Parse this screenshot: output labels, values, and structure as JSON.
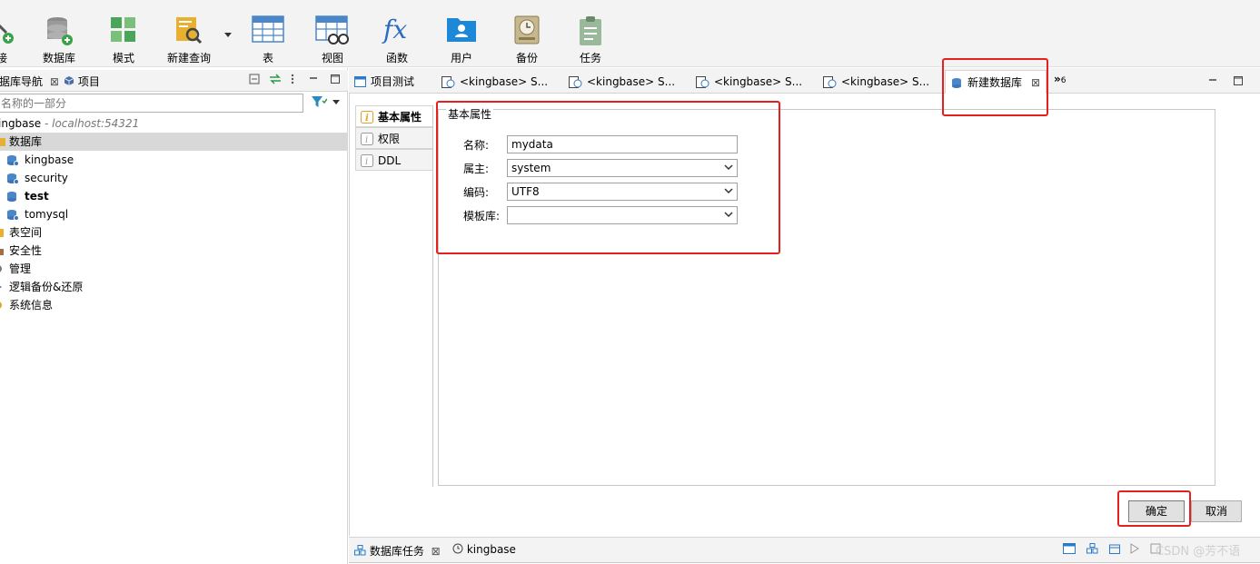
{
  "toolbar": {
    "items": [
      {
        "label": "接",
        "icon": "connect-icon"
      },
      {
        "label": "数据库",
        "icon": "database-add-icon"
      },
      {
        "label": "模式",
        "icon": "schema-icon"
      },
      {
        "label": "新建查询",
        "icon": "new-query-icon"
      },
      {
        "label": "表",
        "icon": "table-icon"
      },
      {
        "label": "视图",
        "icon": "view-icon"
      },
      {
        "label": "函数",
        "icon": "function-icon"
      },
      {
        "label": "用户",
        "icon": "user-icon"
      },
      {
        "label": "备份",
        "icon": "backup-icon"
      },
      {
        "label": "任务",
        "icon": "task-icon"
      }
    ]
  },
  "left_panel": {
    "tabs": [
      {
        "label": "据库导航"
      },
      {
        "label": "项目"
      }
    ],
    "filter": {
      "placeholder": "名称的一部分"
    },
    "tree": [
      {
        "label": "ingbase",
        "host": " - localhost:54321"
      },
      {
        "label": "数据库"
      },
      {
        "label": "kingbase"
      },
      {
        "label": "security"
      },
      {
        "label": "test"
      },
      {
        "label": "tomysql"
      },
      {
        "label": "表空间"
      },
      {
        "label": "安全性"
      },
      {
        "label": "管理"
      },
      {
        "label": "逻辑备份&还原"
      },
      {
        "label": "系统信息"
      }
    ]
  },
  "editor": {
    "tabs": [
      {
        "label": "项目测试"
      },
      {
        "label": "<kingbase> S..."
      },
      {
        "label": "<kingbase> S..."
      },
      {
        "label": "<kingbase> S..."
      },
      {
        "label": "<kingbase> S..."
      },
      {
        "label": "新建数据库"
      }
    ],
    "overflow": "»",
    "overflow_count": "6",
    "side_tabs": [
      {
        "label": "基本属性"
      },
      {
        "label": "权限"
      },
      {
        "label": "DDL"
      }
    ],
    "group_title": "基本属性",
    "form": {
      "name_label": "名称:",
      "name_value": "mydata",
      "owner_label": "属主:",
      "owner_value": "system",
      "encoding_label": "编码:",
      "encoding_value": "UTF8",
      "template_label": "模板库:",
      "template_value": ""
    },
    "ok_label": "确定",
    "cancel_label": "取消"
  },
  "bottom": {
    "tabs": [
      {
        "label": "数据库任务"
      },
      {
        "label": "kingbase"
      }
    ],
    "watermark": "CSDN @芳不语"
  },
  "colors": {
    "highlight_box": "#e52020",
    "toolbar_bg": "#f3f3f3",
    "db_icon_blue": "#4a86c8"
  }
}
